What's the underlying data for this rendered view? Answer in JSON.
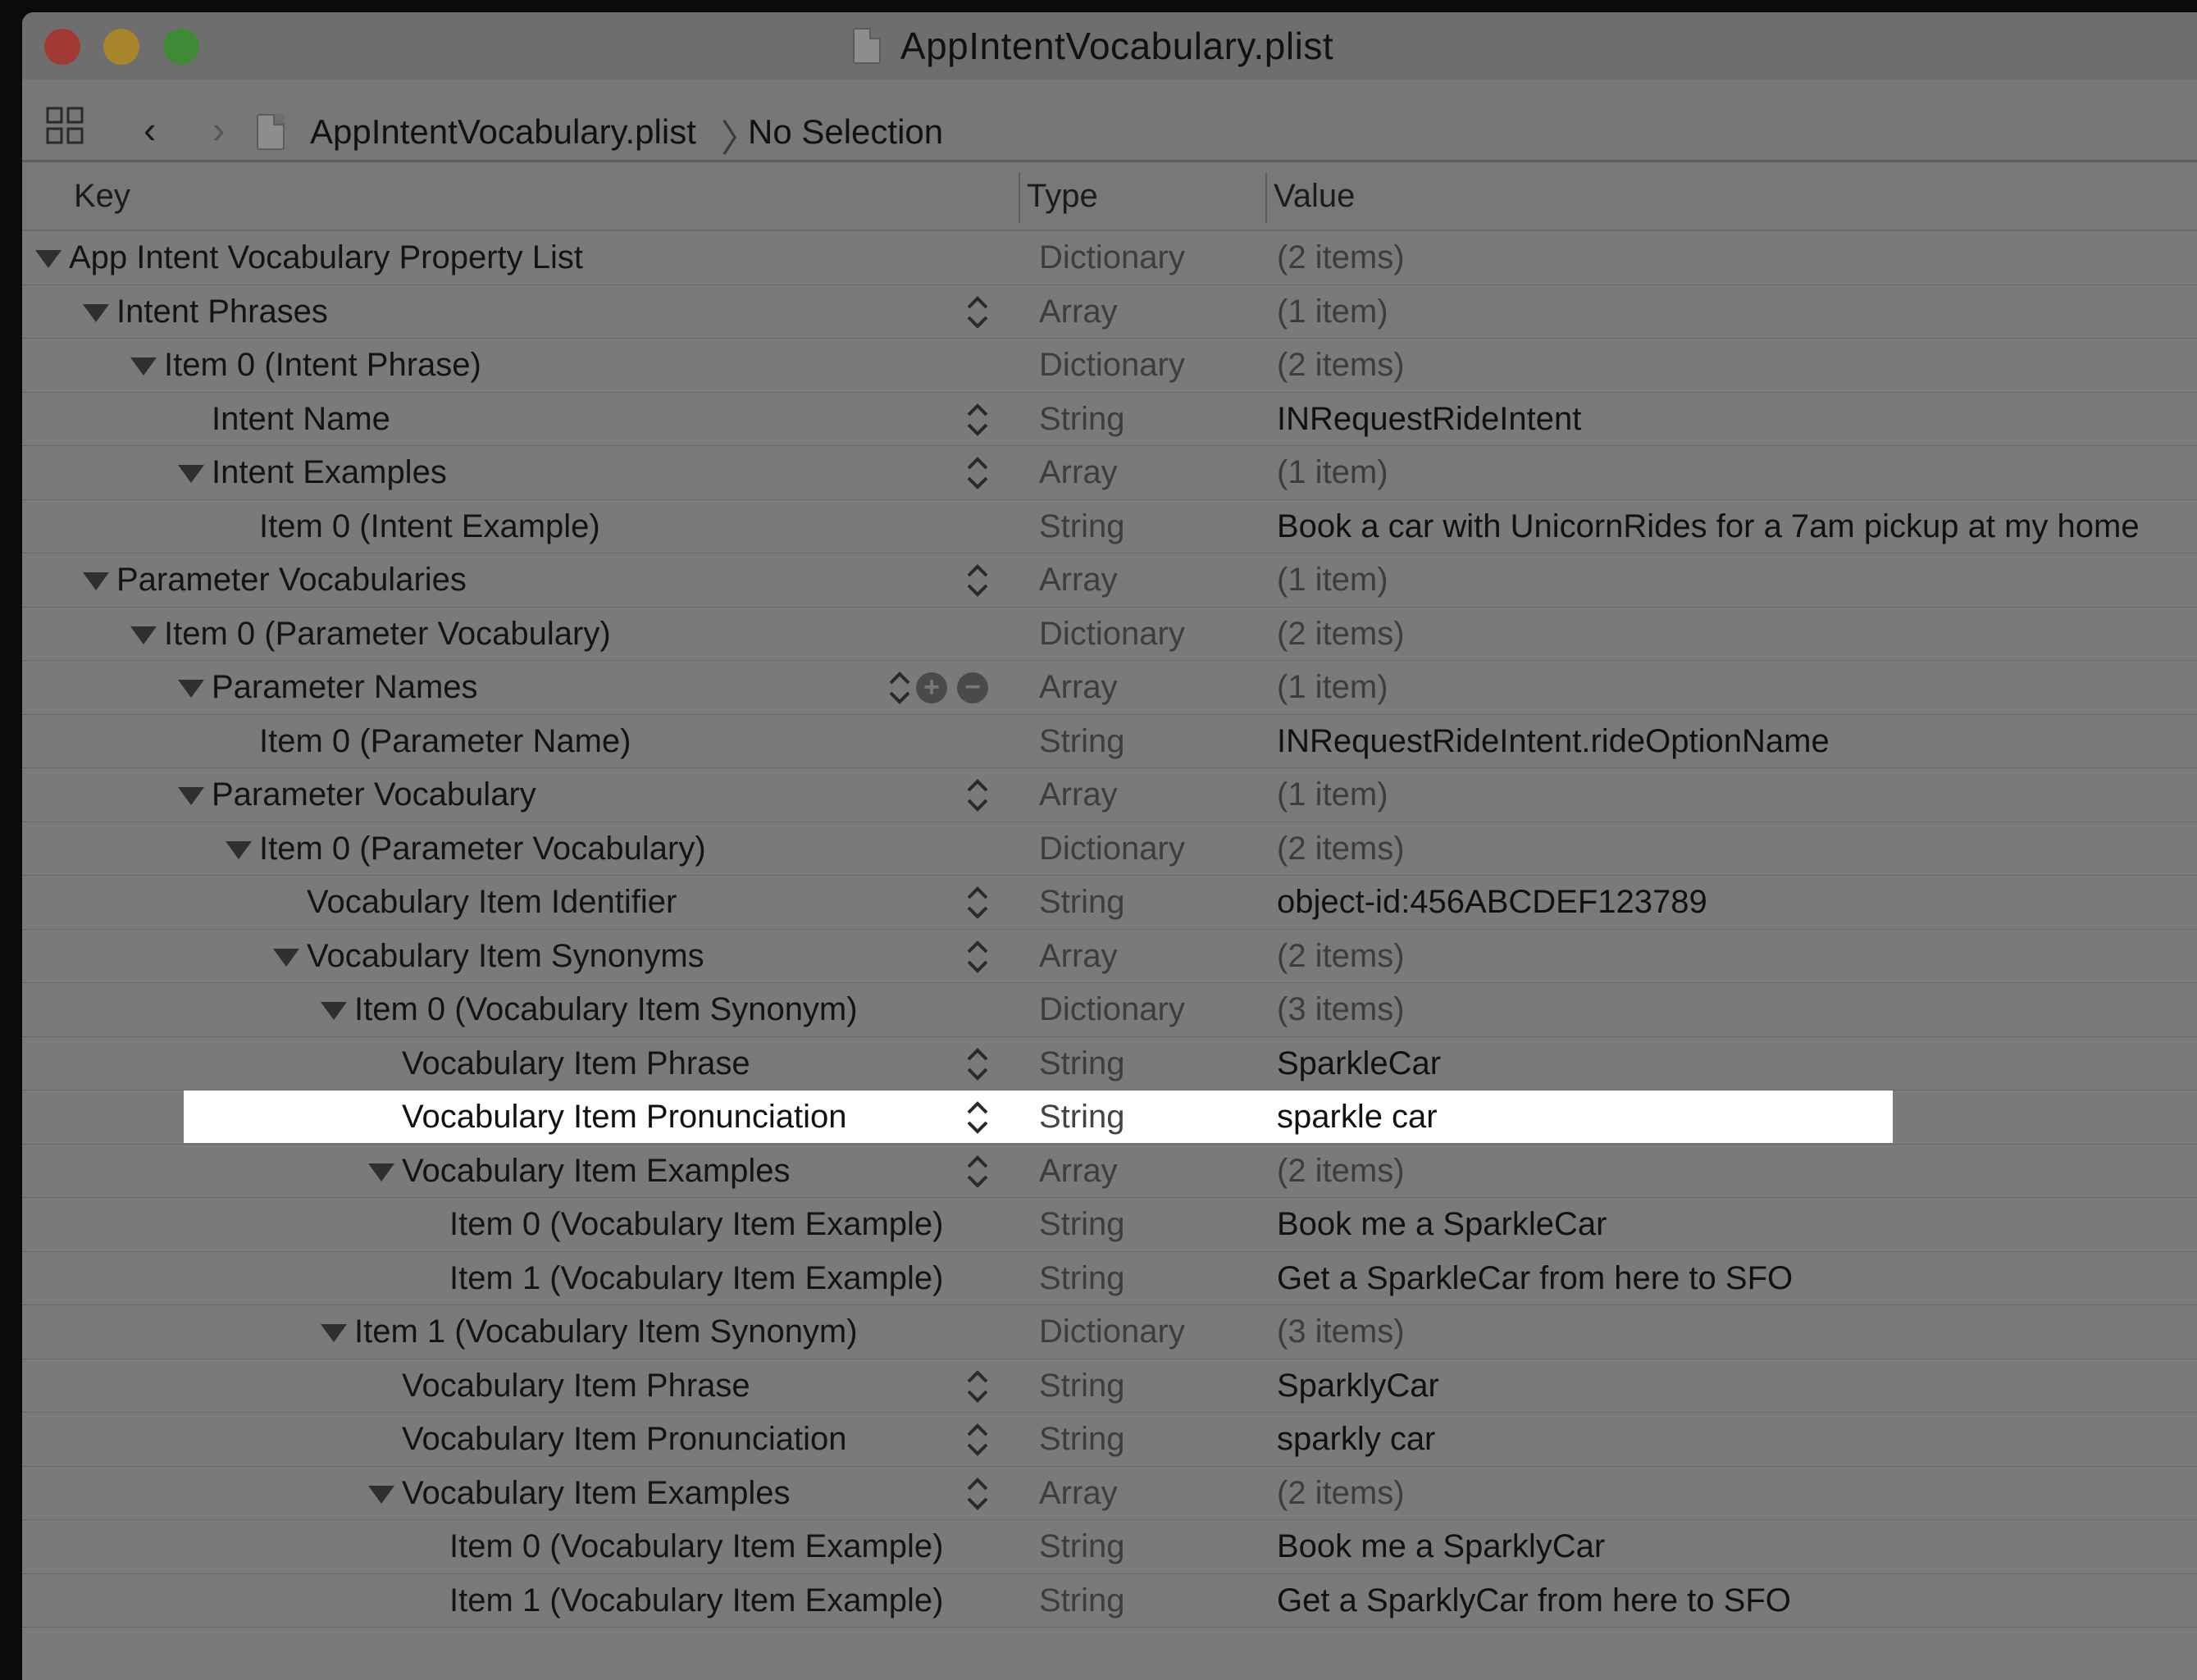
{
  "window": {
    "title": "AppIntentVocabulary.plist"
  },
  "toolbar": {
    "breadcrumb_file": "AppIntentVocabulary.plist",
    "breadcrumb_separator": "〉",
    "breadcrumb_selection": "No Selection",
    "back_glyph": "‹",
    "forward_glyph": "›"
  },
  "columns": {
    "key": "Key",
    "type": "Type",
    "value": "Value"
  },
  "rows": [
    {
      "key": "App Intent Vocabulary Property List",
      "type": "Dictionary",
      "value": "(2 items)",
      "level": 0,
      "expanded": true,
      "stepper": false,
      "value_muted": true
    },
    {
      "key": "Intent Phrases",
      "type": "Array",
      "value": "(1 item)",
      "level": 1,
      "expanded": true,
      "stepper": true,
      "value_muted": true
    },
    {
      "key": "Item 0 (Intent Phrase)",
      "type": "Dictionary",
      "value": "(2 items)",
      "level": 2,
      "expanded": true,
      "stepper": false,
      "value_muted": true
    },
    {
      "key": "Intent Name",
      "type": "String",
      "value": "INRequestRideIntent",
      "level": 3,
      "expanded": null,
      "stepper": true,
      "value_muted": false
    },
    {
      "key": "Intent Examples",
      "type": "Array",
      "value": "(1 item)",
      "level": 3,
      "expanded": true,
      "stepper": true,
      "value_muted": true
    },
    {
      "key": "Item 0 (Intent Example)",
      "type": "String",
      "value": "Book a car with UnicornRides for a 7am pickup at my home",
      "level": 4,
      "expanded": null,
      "stepper": false,
      "value_muted": false
    },
    {
      "key": "Parameter Vocabularies",
      "type": "Array",
      "value": "(1 item)",
      "level": 1,
      "expanded": true,
      "stepper": true,
      "value_muted": true
    },
    {
      "key": "Item 0 (Parameter Vocabulary)",
      "type": "Dictionary",
      "value": "(2 items)",
      "level": 2,
      "expanded": true,
      "stepper": false,
      "value_muted": true
    },
    {
      "key": "Parameter Names",
      "type": "Array",
      "value": "(1 item)",
      "level": 3,
      "expanded": true,
      "stepper": true,
      "value_muted": true,
      "add_remove": true
    },
    {
      "key": "Item 0 (Parameter Name)",
      "type": "String",
      "value": "INRequestRideIntent.rideOptionName",
      "level": 4,
      "expanded": null,
      "stepper": false,
      "value_muted": false
    },
    {
      "key": "Parameter Vocabulary",
      "type": "Array",
      "value": "(1 item)",
      "level": 3,
      "expanded": true,
      "stepper": true,
      "value_muted": true
    },
    {
      "key": "Item 0 (Parameter Vocabulary)",
      "type": "Dictionary",
      "value": "(2 items)",
      "level": 4,
      "expanded": true,
      "stepper": false,
      "value_muted": true
    },
    {
      "key": "Vocabulary Item Identifier",
      "type": "String",
      "value": "object-id:456ABCDEF123789",
      "level": 5,
      "expanded": null,
      "stepper": true,
      "value_muted": false
    },
    {
      "key": "Vocabulary Item Synonyms",
      "type": "Array",
      "value": "(2 items)",
      "level": 5,
      "expanded": true,
      "stepper": true,
      "value_muted": true
    },
    {
      "key": "Item 0 (Vocabulary Item Synonym)",
      "type": "Dictionary",
      "value": "(3 items)",
      "level": 6,
      "expanded": true,
      "stepper": false,
      "value_muted": true
    },
    {
      "key": "Vocabulary Item Phrase",
      "type": "String",
      "value": "SparkleCar",
      "level": 7,
      "expanded": null,
      "stepper": true,
      "value_muted": false
    },
    {
      "key": "Vocabulary Item Pronunciation",
      "type": "String",
      "value": "sparkle car",
      "level": 7,
      "expanded": null,
      "stepper": true,
      "value_muted": false,
      "selected": true
    },
    {
      "key": "Vocabulary Item Examples",
      "type": "Array",
      "value": "(2 items)",
      "level": 7,
      "expanded": true,
      "stepper": true,
      "value_muted": true
    },
    {
      "key": "Item 0 (Vocabulary Item Example)",
      "type": "String",
      "value": "Book me a SparkleCar",
      "level": 8,
      "expanded": null,
      "stepper": false,
      "value_muted": false
    },
    {
      "key": "Item 1 (Vocabulary Item Example)",
      "type": "String",
      "value": "Get a SparkleCar from here to SFO",
      "level": 8,
      "expanded": null,
      "stepper": false,
      "value_muted": false
    },
    {
      "key": "Item 1 (Vocabulary Item Synonym)",
      "type": "Dictionary",
      "value": "(3 items)",
      "level": 6,
      "expanded": true,
      "stepper": false,
      "value_muted": true
    },
    {
      "key": "Vocabulary Item Phrase",
      "type": "String",
      "value": "SparklyCar",
      "level": 7,
      "expanded": null,
      "stepper": true,
      "value_muted": false
    },
    {
      "key": "Vocabulary Item Pronunciation",
      "type": "String",
      "value": "sparkly car",
      "level": 7,
      "expanded": null,
      "stepper": true,
      "value_muted": false
    },
    {
      "key": "Vocabulary Item Examples",
      "type": "Array",
      "value": "(2 items)",
      "level": 7,
      "expanded": true,
      "stepper": true,
      "value_muted": true
    },
    {
      "key": "Item 0 (Vocabulary Item Example)",
      "type": "String",
      "value": "Book me a SparklyCar",
      "level": 8,
      "expanded": null,
      "stepper": false,
      "value_muted": false
    },
    {
      "key": "Item 1 (Vocabulary Item Example)",
      "type": "String",
      "value": "Get a SparklyCar from here to SFO",
      "level": 8,
      "expanded": null,
      "stepper": false,
      "value_muted": false
    }
  ]
}
